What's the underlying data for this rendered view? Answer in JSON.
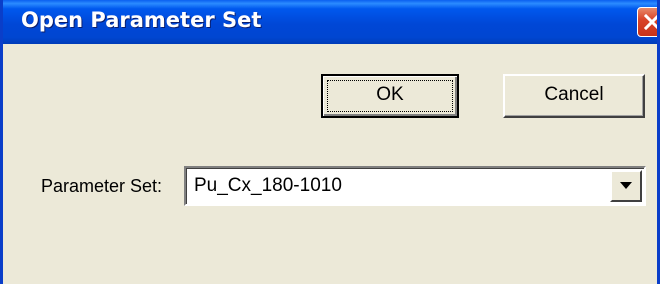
{
  "window": {
    "title": "Open Parameter Set",
    "close_icon": "close-icon"
  },
  "buttons": {
    "ok_label": "OK",
    "cancel_label": "Cancel"
  },
  "parameter_set": {
    "label": "Parameter Set:",
    "selected_value": "Pu_Cx_180-1010",
    "dropdown_icon": "chevron-down-icon"
  },
  "colors": {
    "titlebar": "#0046d1",
    "dialog_background": "#ece9d8",
    "close_button": "#d9452a"
  }
}
